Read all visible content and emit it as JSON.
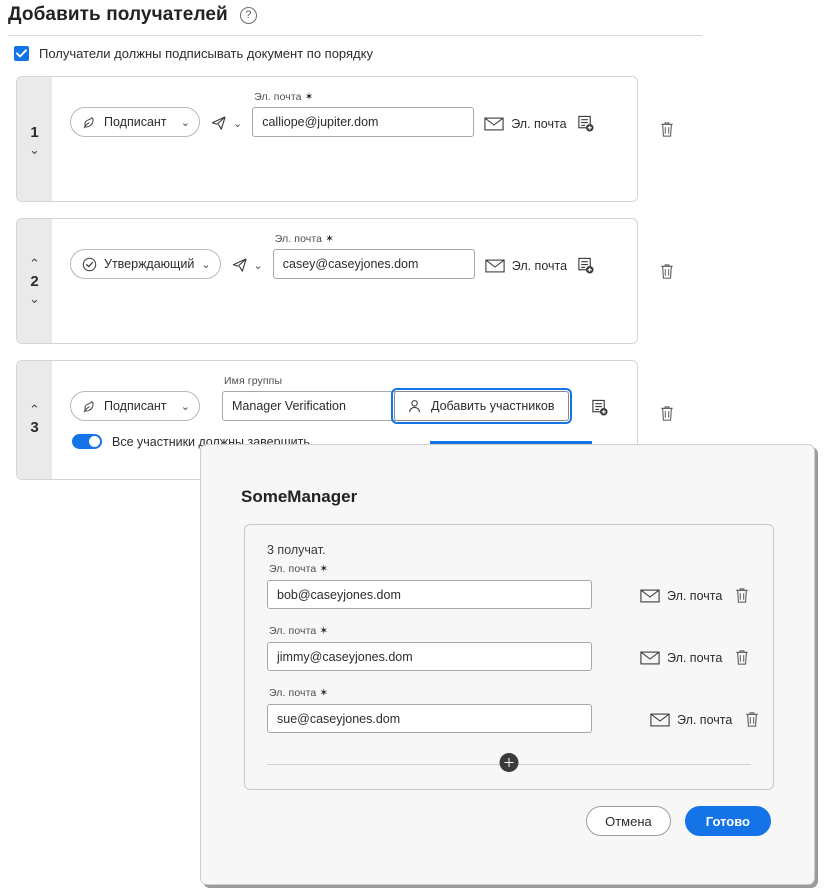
{
  "header": {
    "title": "Добавить получателей",
    "help_icon": "help-circle-icon",
    "order_checkbox_label": "Получатели должны подписывать документ по порядку",
    "order_checkbox_checked": true
  },
  "recipients": [
    {
      "number": "1",
      "role": "Подписант",
      "role_icon": "signature-pen-icon",
      "send_icon": "paper-plane-icon",
      "field_label": "Эл. почта",
      "required_mark": "✶",
      "value": "calliope@jupiter.dom",
      "placeholder": "",
      "delivery_label": "Эл. почта",
      "delivery_icon": "envelope-icon",
      "form_icon": "add-form-icon",
      "delete_icon": "trash-icon"
    },
    {
      "number": "2",
      "role": "Утверждающий",
      "role_icon": "check-badge-icon",
      "send_icon": "paper-plane-icon",
      "field_label": "Эл. почта",
      "required_mark": "✶",
      "value": "casey@caseyjones.dom",
      "placeholder": "",
      "delivery_label": "Эл. почта",
      "delivery_icon": "envelope-icon",
      "form_icon": "add-form-icon",
      "delete_icon": "trash-icon"
    },
    {
      "number": "3",
      "role": "Подписант",
      "role_icon": "signature-pen-icon",
      "field_label": "Имя группы",
      "value": "Manager Verification",
      "placeholder": "",
      "add_members_label": "Добавить участников",
      "add_members_icon": "person-add-icon",
      "form_icon": "add-form-icon",
      "delete_icon": "trash-icon",
      "toggle_label": "Все участники должны завершить",
      "toggle_on": true
    }
  ],
  "modal": {
    "title": "SomeManager",
    "recipient_count_label": "3 получат.",
    "rows": [
      {
        "field_label": "Эл. почта",
        "required_mark": "✶",
        "value": "bob@caseyjones.dom",
        "delivery_label": "Эл. почта",
        "delivery_icon": "envelope-icon",
        "delete_icon": "trash-icon"
      },
      {
        "field_label": "Эл. почта",
        "required_mark": "✶",
        "value": "jimmy@caseyjones.dom",
        "delivery_label": "Эл. почта",
        "delivery_icon": "envelope-icon",
        "delete_icon": "trash-icon"
      },
      {
        "field_label": "Эл. почта",
        "required_mark": "✶",
        "value": "sue@caseyjones.dom",
        "delivery_label": "Эл. почта",
        "delivery_icon": "envelope-icon",
        "delete_icon": "trash-icon"
      }
    ],
    "add_row_icon": "plus-circle-icon",
    "cancel_label": "Отмена",
    "done_label": "Готово"
  },
  "colors": {
    "accent": "#1473e6",
    "strip": "#eaeaea",
    "modal_bg": "#f7f7f7",
    "border": "#cfcfcf"
  }
}
